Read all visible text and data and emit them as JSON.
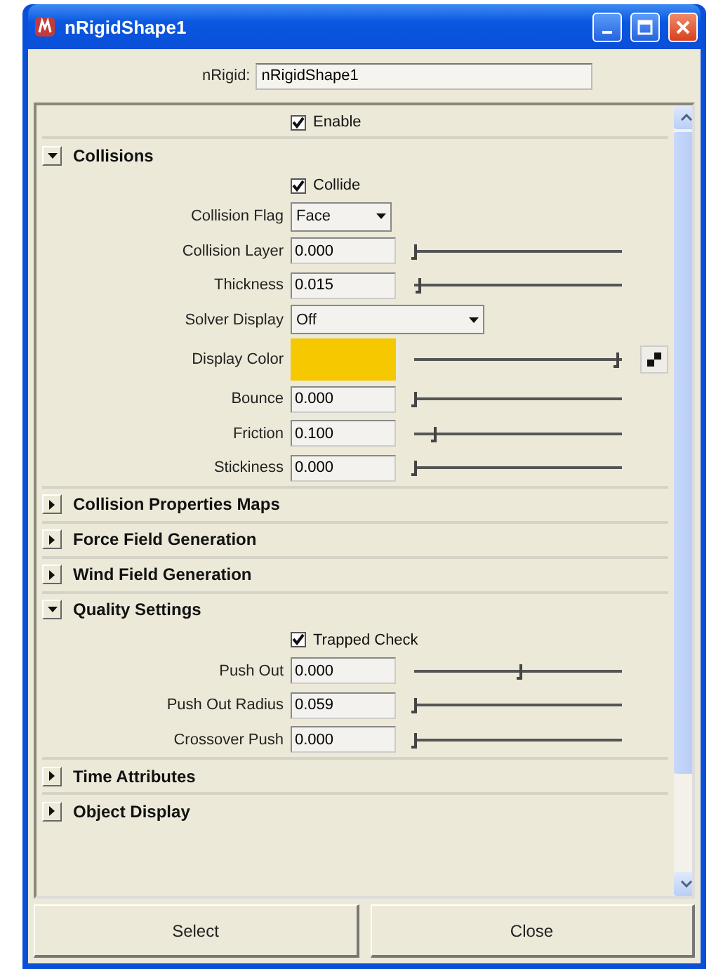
{
  "window": {
    "title": "nRigidShape1"
  },
  "name_field": {
    "label": "nRigid:",
    "value": "nRigidShape1"
  },
  "enable": {
    "label": "Enable",
    "checked": true
  },
  "sections": [
    {
      "title": "Collisions",
      "expanded": true,
      "rows": [
        {
          "kind": "checkbox",
          "label": "Collide",
          "checked": true
        },
        {
          "kind": "enum",
          "label": "Collision Flag",
          "value": "Face"
        },
        {
          "kind": "slider",
          "label": "Collision Layer",
          "value": "0.000",
          "level": 0.0
        },
        {
          "kind": "slider",
          "label": "Thickness",
          "value": "0.015",
          "level": 0.02
        },
        {
          "kind": "wide_enum",
          "label": "Solver Display",
          "value": "Off"
        },
        {
          "kind": "color",
          "label": "Display Color",
          "color": "#f5c800",
          "level": 1.0
        },
        {
          "kind": "slider",
          "label": "Bounce",
          "value": "0.000",
          "level": 0.0
        },
        {
          "kind": "slider",
          "label": "Friction",
          "value": "0.100",
          "level": 0.1
        },
        {
          "kind": "slider",
          "label": "Stickiness",
          "value": "0.000",
          "level": 0.0
        }
      ]
    },
    {
      "title": "Collision Properties Maps",
      "expanded": false
    },
    {
      "title": "Force Field Generation",
      "expanded": false
    },
    {
      "title": "Wind Field Generation",
      "expanded": false
    },
    {
      "title": "Quality Settings",
      "expanded": true,
      "rows": [
        {
          "kind": "checkbox",
          "label": "Trapped Check",
          "checked": true
        },
        {
          "kind": "slider",
          "label": "Push Out",
          "value": "0.000",
          "level": 0.52
        },
        {
          "kind": "slider",
          "label": "Push Out Radius",
          "value": "0.059",
          "level": 0.0
        },
        {
          "kind": "slider",
          "label": "Crossover Push",
          "value": "0.000",
          "level": 0.0
        }
      ]
    },
    {
      "title": "Time Attributes",
      "expanded": false
    },
    {
      "title": "Object Display",
      "expanded": false
    }
  ],
  "buttons": [
    "Select",
    "Close"
  ]
}
